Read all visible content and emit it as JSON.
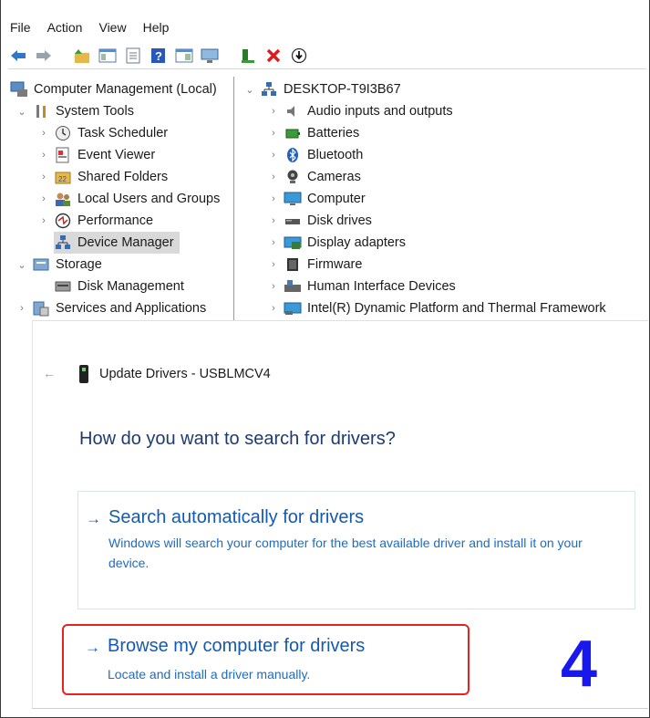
{
  "menu": {
    "file": "File",
    "action": "Action",
    "view": "View",
    "help": "Help"
  },
  "toolbar": {
    "icons": [
      "back-arrow-icon",
      "forward-arrow-icon",
      "up-folder-icon",
      "show-hide-tree-icon",
      "properties-icon",
      "help-icon",
      "action-pane-icon",
      "monitor-icon",
      "enable-device-icon",
      "remove-device-icon",
      "update-driver-icon"
    ]
  },
  "left_tree": {
    "root": "Computer Management (Local)",
    "system_tools": "System Tools",
    "task_scheduler": "Task Scheduler",
    "event_viewer": "Event Viewer",
    "shared_folders": "Shared Folders",
    "local_users": "Local Users and Groups",
    "performance": "Performance",
    "device_manager": "Device Manager",
    "storage": "Storage",
    "disk_management": "Disk Management",
    "services": "Services and Applications"
  },
  "right_tree": {
    "root": "DESKTOP-T9I3B67",
    "items": [
      "Audio inputs and outputs",
      "Batteries",
      "Bluetooth",
      "Cameras",
      "Computer",
      "Disk drives",
      "Display adapters",
      "Firmware",
      "Human Interface Devices",
      "Intel(R) Dynamic Platform and Thermal Framework"
    ]
  },
  "dialog": {
    "back": "←",
    "title": "Update Drivers - USBLMCV4",
    "question": "How do you want to search for drivers?",
    "auto_arrow": "→",
    "auto_title": "Search automatically for drivers",
    "auto_desc_line1": "Windows will search your computer for the best available driver and install it on your",
    "auto_desc_line2": "device.",
    "browse_arrow": "→",
    "browse_title": "Browse my computer for drivers",
    "browse_desc": "Locate and install a driver manually."
  },
  "annotation": {
    "step": "4",
    "highlight_color": "#e8221f",
    "step_color": "#1717ee"
  }
}
